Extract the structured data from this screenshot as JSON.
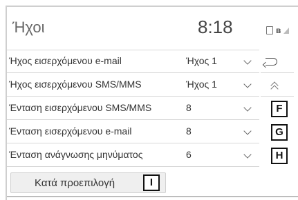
{
  "header": {
    "title": "Ήχοι",
    "time": "8:18"
  },
  "status_icons": [
    "battery-icon",
    "bluetooth-icon",
    "signal-icon"
  ],
  "rows": [
    {
      "label": "Ήχος εισερχόμενου e-mail",
      "value": "Ήχος 1"
    },
    {
      "label": "Ήχος εισερχόμενου SMS/MMS",
      "value": "Ήχος 1"
    },
    {
      "label": "Ένταση εισερχόμενου SMS/MMS",
      "value": "8"
    },
    {
      "label": "Ένταση εισερχόμενου e-mail",
      "value": "8"
    },
    {
      "label": "Ένταση ανάγνωσης μηνύματος",
      "value": "6"
    }
  ],
  "callouts": {
    "f": "F",
    "g": "G",
    "h": "H",
    "i": "I"
  },
  "default_button": {
    "label": "Κατά προεπιλογή"
  }
}
